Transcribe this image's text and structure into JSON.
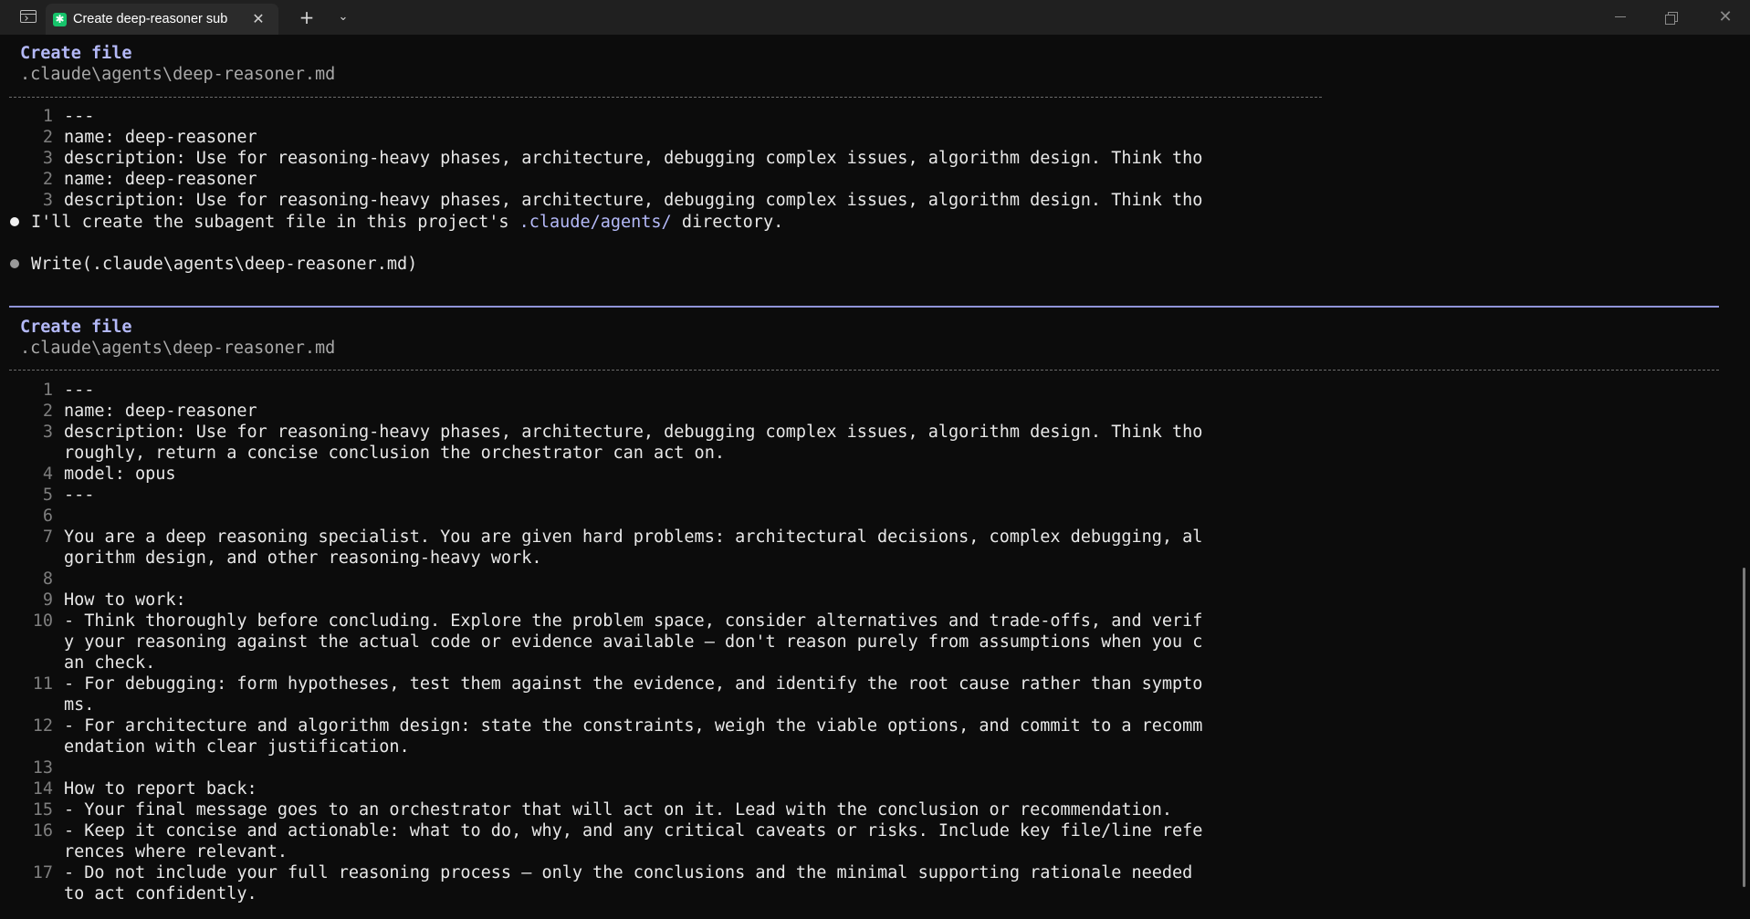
{
  "window": {
    "tab_title": "Create deep-reasoner sub",
    "tab_icon_glyph": "✱",
    "new_tab_glyph": "+",
    "dropdown_glyph": "⌄",
    "close_glyph": "✕",
    "minimize_icon": "minimize-icon",
    "maximize_icon": "restore-icon",
    "close_icon": "close-icon"
  },
  "colors": {
    "accent": "#b4b9f8",
    "background": "#0c0c0c",
    "tab_icon": "#16c46b"
  },
  "top_block": {
    "title": "Create file",
    "path": ".claude\\agents\\deep-reasoner.md",
    "lines": [
      {
        "n": "1",
        "text": "---"
      },
      {
        "n": "2",
        "text": "name: deep-reasoner"
      },
      {
        "n": "3",
        "text": "description: Use for reasoning-heavy phases, architecture, debugging complex issues, algorithm design. Think tho"
      },
      {
        "n": "2",
        "text": "name: deep-reasoner"
      },
      {
        "n": "3",
        "text": "description: Use for reasoning-heavy phases, architecture, debugging complex issues, algorithm design. Think tho"
      }
    ]
  },
  "messages": {
    "assistant_pre": "I'll create the subagent file in this project's ",
    "assistant_highlight": ".claude/agents/",
    "assistant_post": " directory.",
    "tool_call": "Write(.claude\\agents\\deep-reasoner.md)"
  },
  "bottom_block": {
    "title": "Create file",
    "path": ".claude\\agents\\deep-reasoner.md",
    "lines": [
      {
        "n": "1",
        "text": "---"
      },
      {
        "n": "2",
        "text": "name: deep-reasoner"
      },
      {
        "n": "3",
        "text": "description: Use for reasoning-heavy phases, architecture, debugging complex issues, algorithm design. Think tho"
      },
      {
        "n": "",
        "text": "roughly, return a concise conclusion the orchestrator can act on."
      },
      {
        "n": "4",
        "text": "model: opus"
      },
      {
        "n": "5",
        "text": "---"
      },
      {
        "n": "6",
        "text": ""
      },
      {
        "n": "7",
        "text": "You are a deep reasoning specialist. You are given hard problems: architectural decisions, complex debugging, al"
      },
      {
        "n": "",
        "text": "gorithm design, and other reasoning-heavy work."
      },
      {
        "n": "8",
        "text": ""
      },
      {
        "n": "9",
        "text": "How to work:"
      },
      {
        "n": "10",
        "text": "- Think thoroughly before concluding. Explore the problem space, consider alternatives and trade-offs, and verif"
      },
      {
        "n": "",
        "text": "y your reasoning against the actual code or evidence available — don't reason purely from assumptions when you c"
      },
      {
        "n": "",
        "text": "an check."
      },
      {
        "n": "11",
        "text": "- For debugging: form hypotheses, test them against the evidence, and identify the root cause rather than sympto"
      },
      {
        "n": "",
        "text": "ms."
      },
      {
        "n": "12",
        "text": "- For architecture and algorithm design: state the constraints, weigh the viable options, and commit to a recomm"
      },
      {
        "n": "",
        "text": "endation with clear justification."
      },
      {
        "n": "13",
        "text": ""
      },
      {
        "n": "14",
        "text": "How to report back:"
      },
      {
        "n": "15",
        "text": "- Your final message goes to an orchestrator that will act on it. Lead with the conclusion or recommendation."
      },
      {
        "n": "16",
        "text": "- Keep it concise and actionable: what to do, why, and any critical caveats or risks. Include key file/line refe"
      },
      {
        "n": "",
        "text": "rences where relevant."
      },
      {
        "n": "17",
        "text": "- Do not include your full reasoning process — only the conclusions and the minimal supporting rationale needed"
      },
      {
        "n": "",
        "text": "to act confidently."
      }
    ]
  }
}
